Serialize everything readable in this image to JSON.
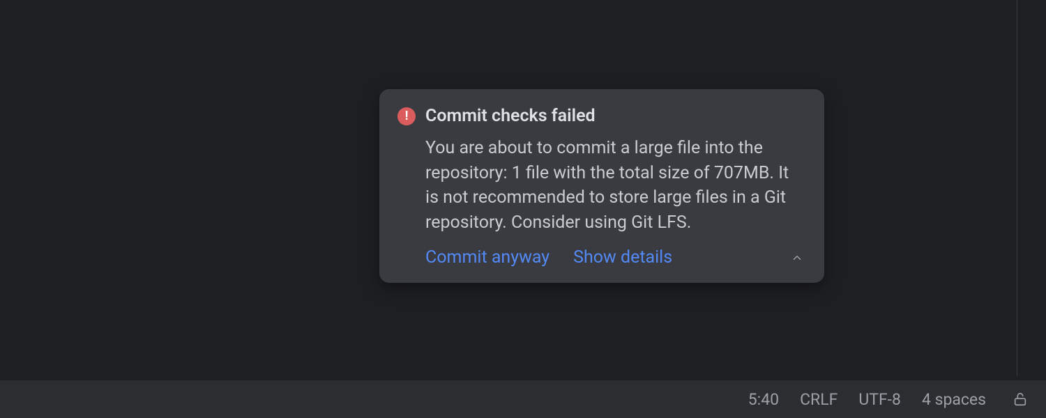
{
  "notification": {
    "title": "Commit checks failed",
    "body": "You are about to commit a large file into the repository: 1 file with the total size of 707MB. It is not recommended to store large files in a Git repository. Consider using Git LFS.",
    "actions": {
      "commit_anyway": "Commit anyway",
      "show_details": "Show details"
    }
  },
  "status_bar": {
    "cursor_position": "5:40",
    "line_ending": "CRLF",
    "encoding": "UTF-8",
    "indent": "4 spaces"
  }
}
